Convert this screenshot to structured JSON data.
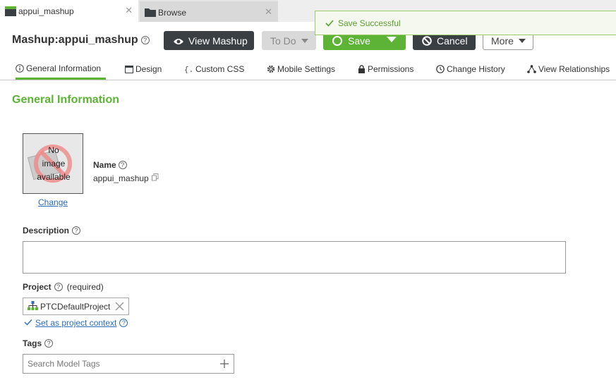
{
  "tabs": [
    {
      "label": "appui_mashup",
      "icon": "mashup-icon",
      "active": true
    },
    {
      "label": "Browse",
      "icon": "folder-icon",
      "active": false
    }
  ],
  "toast": {
    "message": "Save Successful"
  },
  "header": {
    "title": "Mashup:appui_mashup",
    "view_mashup": "View Mashup",
    "todo": "To Do",
    "save": "Save",
    "cancel": "Cancel",
    "more": "More"
  },
  "nav": [
    {
      "label": "General Information",
      "icon": "info-icon",
      "active": true
    },
    {
      "label": "Design",
      "icon": "design-icon"
    },
    {
      "label": "Custom CSS",
      "icon": "css-icon"
    },
    {
      "label": "Mobile Settings",
      "icon": "gear-icon"
    },
    {
      "label": "Permissions",
      "icon": "lock-icon"
    },
    {
      "label": "Change History",
      "icon": "clock-icon"
    },
    {
      "label": "View Relationships",
      "icon": "relationships-icon"
    }
  ],
  "section": {
    "title": "General Information"
  },
  "image": {
    "line1": "No",
    "line2": "image",
    "line3": "available",
    "change": "Change"
  },
  "name": {
    "label": "Name",
    "value": "appui_mashup"
  },
  "description": {
    "label": "Description",
    "value": ""
  },
  "project": {
    "label": "Project",
    "required": "(required)",
    "value": "PTCDefaultProject",
    "context_link": "Set as project context"
  },
  "tags": {
    "label": "Tags",
    "placeholder": "Search Model Tags"
  },
  "colors": {
    "accent": "#5cb335",
    "dark": "#3a3f44",
    "link": "#2a6ebb"
  }
}
